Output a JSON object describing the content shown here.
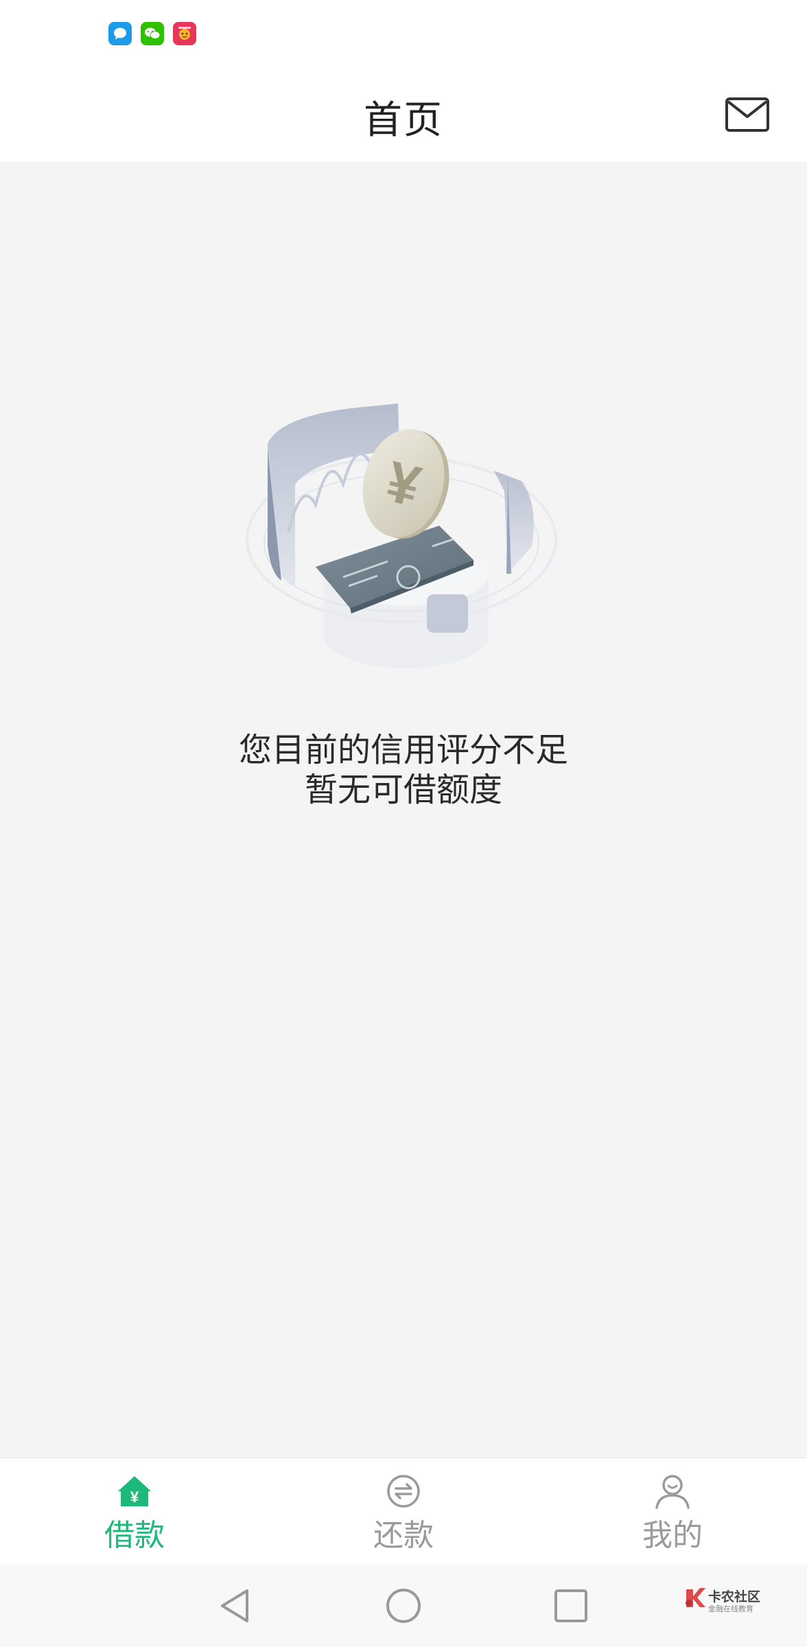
{
  "status_bar": {
    "notifications": [
      "message-app-icon",
      "wechat-icon",
      "game-app-icon"
    ]
  },
  "header": {
    "title": "首页",
    "mail_icon": "mail-icon"
  },
  "empty_state": {
    "line1": "您目前的信用评分不足",
    "line2": "暂无可借额度"
  },
  "tabs": [
    {
      "label": "借款",
      "icon": "loan-home-icon",
      "active": true
    },
    {
      "label": "还款",
      "icon": "repay-exchange-icon",
      "active": false
    },
    {
      "label": "我的",
      "icon": "profile-icon",
      "active": false
    }
  ],
  "system_nav": {
    "buttons": [
      "back-icon",
      "home-icon",
      "recents-icon"
    ]
  },
  "watermark": {
    "title": "卡农社区",
    "subtitle": "金融在线教育"
  },
  "colors": {
    "accent": "#1cb97a",
    "inactive": "#9a9a9a",
    "background": "#f4f4f4"
  }
}
